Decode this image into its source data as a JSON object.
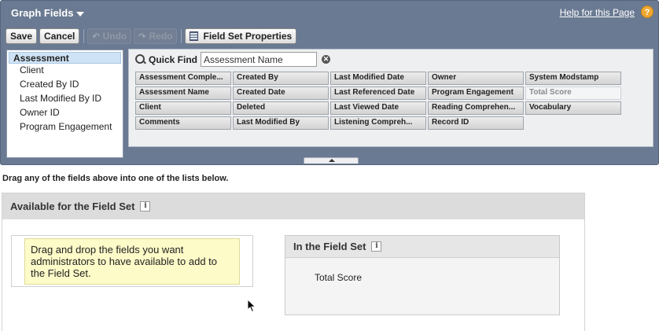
{
  "palette": {
    "title": "Graph Fields",
    "help_link": "Help for this Page",
    "help_icon": "?"
  },
  "toolbar": {
    "save": "Save",
    "cancel": "Cancel",
    "undo": "Undo",
    "redo": "Redo",
    "field_set_properties": "Field Set Properties"
  },
  "objects": {
    "selected": "Assessment",
    "items": [
      "Client",
      "Created By ID",
      "Last Modified By ID",
      "Owner ID",
      "Program Engagement"
    ]
  },
  "quick_find": {
    "label": "Quick Find",
    "value": "Assessment Name"
  },
  "fields": [
    [
      "Assessment Comple...",
      "Created By",
      "Last Modified Date",
      "Owner",
      "System Modstamp"
    ],
    [
      "Assessment Name",
      "Created Date",
      "Last Referenced Date",
      "Program Engagement",
      "Total Score"
    ],
    [
      "Client",
      "Deleted",
      "Last Viewed Date",
      "Reading Comprehen...",
      "Vocabulary"
    ],
    [
      "Comments",
      "Last Modified By",
      "Listening Compreh...",
      "Record ID",
      ""
    ]
  ],
  "used_fields": [
    "Total Score"
  ],
  "instruction": "Drag any of the fields above into one of the lists below.",
  "available": {
    "title": "Available for the Field Set",
    "hint": "Drag and drop the fields you want administrators to have available to add to the Field Set."
  },
  "in_field_set": {
    "title": "In the Field Set",
    "items": [
      "Total Score"
    ]
  },
  "info_glyph": "i"
}
